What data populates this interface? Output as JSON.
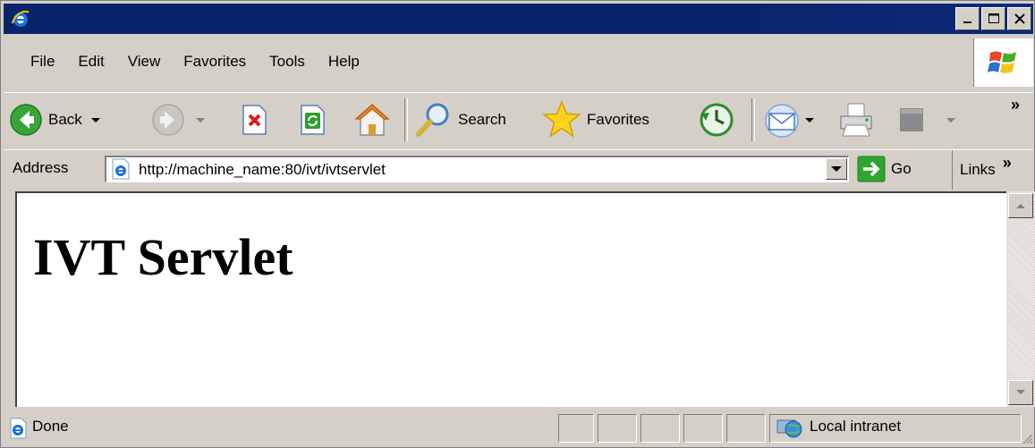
{
  "window": {
    "title": ""
  },
  "menu": {
    "items": [
      "File",
      "Edit",
      "View",
      "Favorites",
      "Tools",
      "Help"
    ]
  },
  "toolbar": {
    "back_label": "Back",
    "search_label": "Search",
    "favorites_label": "Favorites",
    "overflow": "»"
  },
  "address": {
    "label": "Address",
    "url": "http://machine_name:80/ivt/ivtservlet",
    "go_label": "Go",
    "links_label": "Links",
    "links_overflow": "»"
  },
  "page": {
    "heading": "IVT Servlet"
  },
  "status": {
    "text": "Done",
    "zone": "Local intranet"
  },
  "colors": {
    "titlebar": "#0a246a",
    "chrome": "#d4d0c8",
    "accent_green": "#2fa62f"
  },
  "icons": [
    "ie-logo-icon",
    "minimize-icon",
    "maximize-icon",
    "close-icon",
    "windows-flag-icon",
    "back-arrow-icon",
    "forward-arrow-icon",
    "stop-icon",
    "refresh-icon",
    "home-icon",
    "search-icon",
    "favorites-star-icon",
    "history-icon",
    "mail-icon",
    "print-icon",
    "edit-icon",
    "go-arrow-icon",
    "page-icon",
    "intranet-globe-icon"
  ]
}
